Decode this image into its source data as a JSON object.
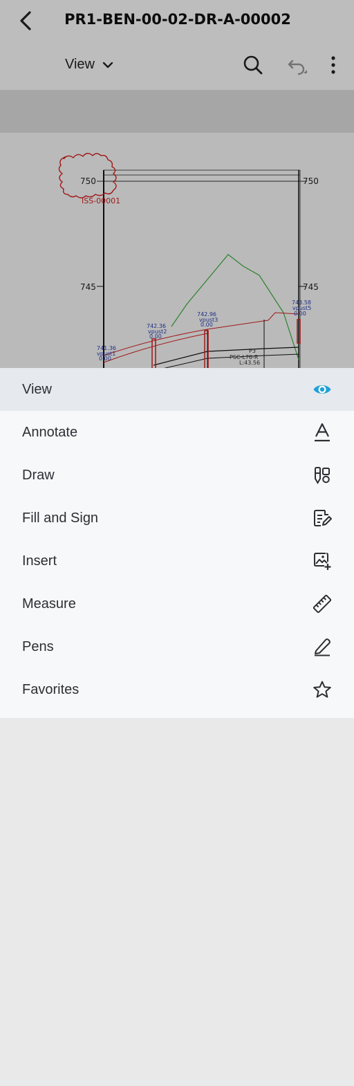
{
  "header": {
    "title": "PR1-BEN-00-02-DR-A-00002",
    "view_selector": "View"
  },
  "drawing": {
    "cloud_label": "ISS-00001",
    "axis_labels": [
      "750",
      "745"
    ],
    "point_labels": [
      {
        "value": "742.96",
        "name": "vpust3",
        "offset": "0.00"
      },
      {
        "value": "742.36",
        "name": "vpust2",
        "offset": "0.00"
      },
      {
        "value": "741.36",
        "name": "vpust1",
        "offset": "0.00"
      },
      {
        "value": "743.58",
        "name": "vpust5",
        "offset": "0.00"
      }
    ],
    "segment_labels": [
      "P3",
      "PSC-L76-R",
      "L:43.56"
    ]
  },
  "menu": {
    "items": [
      {
        "label": "View",
        "icon": "eye-icon"
      },
      {
        "label": "Annotate",
        "icon": "text-annotate-icon"
      },
      {
        "label": "Draw",
        "icon": "draw-tools-icon"
      },
      {
        "label": "Fill and Sign",
        "icon": "fill-sign-icon"
      },
      {
        "label": "Insert",
        "icon": "insert-image-icon"
      },
      {
        "label": "Measure",
        "icon": "ruler-icon"
      },
      {
        "label": "Pens",
        "icon": "pen-icon"
      },
      {
        "label": "Favorites",
        "icon": "star-icon"
      }
    ],
    "active_color": "#1da1d6"
  }
}
